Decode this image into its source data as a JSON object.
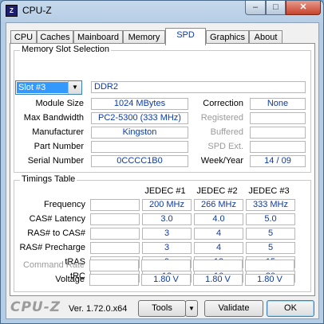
{
  "window": {
    "title": "CPU-Z",
    "min": "–",
    "max": "□",
    "close": "✕"
  },
  "tabs": [
    "CPU",
    "Caches",
    "Mainboard",
    "Memory",
    "SPD",
    "Graphics",
    "About"
  ],
  "active_tab": "SPD",
  "memory_slot": {
    "group_title": "Memory Slot Selection",
    "slot_selected": "Slot #3",
    "type": "DDR2",
    "module_size_label": "Module Size",
    "module_size": "1024 MBytes",
    "max_bandwidth_label": "Max Bandwidth",
    "max_bandwidth": "PC2-5300 (333 MHz)",
    "manufacturer_label": "Manufacturer",
    "manufacturer": "Kingston",
    "part_number_label": "Part Number",
    "part_number": "",
    "serial_number_label": "Serial Number",
    "serial_number": "0CCCC1B0",
    "correction_label": "Correction",
    "correction": "None",
    "registered_label": "Registered",
    "registered": "",
    "buffered_label": "Buffered",
    "buffered": "",
    "spd_ext_label": "SPD Ext.",
    "spd_ext": "",
    "week_year_label": "Week/Year",
    "week_year": "14 / 09"
  },
  "timings": {
    "group_title": "Timings Table",
    "columns": [
      "JEDEC #1",
      "JEDEC #2",
      "JEDEC #3"
    ],
    "rows": [
      {
        "label": "Frequency",
        "values": [
          "200 MHz",
          "266 MHz",
          "333 MHz"
        ]
      },
      {
        "label": "CAS# Latency",
        "values": [
          "3.0",
          "4.0",
          "5.0"
        ]
      },
      {
        "label": "RAS# to CAS#",
        "values": [
          "3",
          "4",
          "5"
        ]
      },
      {
        "label": "RAS# Precharge",
        "values": [
          "3",
          "4",
          "5"
        ]
      },
      {
        "label": "tRAS",
        "values": [
          "9",
          "12",
          "15"
        ]
      },
      {
        "label": "tRC",
        "values": [
          "12",
          "16",
          "20"
        ]
      },
      {
        "label": "Command Rate",
        "values": [
          "",
          "",
          ""
        ]
      },
      {
        "label": "Voltage",
        "values": [
          "1.80 V",
          "1.80 V",
          "1.80 V"
        ]
      }
    ]
  },
  "bottom": {
    "logo": "CPU-Z",
    "version": "Ver. 1.72.0.x64",
    "tools": "Tools",
    "tools_arrow": "▼",
    "validate": "Validate",
    "ok": "OK"
  }
}
